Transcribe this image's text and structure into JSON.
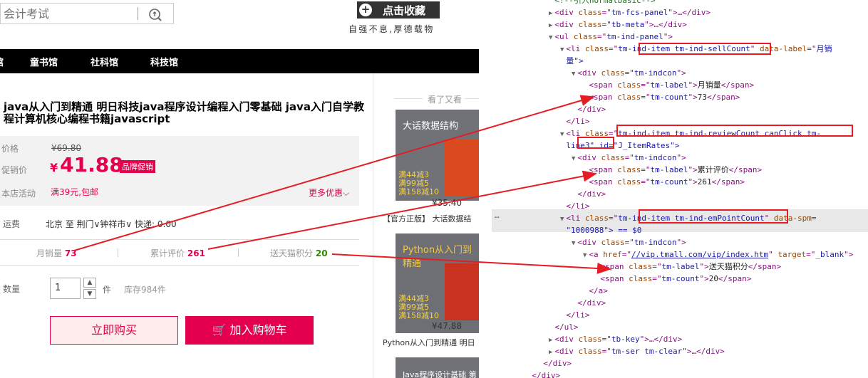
{
  "header": {
    "search_placeholder": "会计考试",
    "favorite_label": "点击收藏",
    "favorite_plus": "+",
    "motto": "自强不息,厚德载物"
  },
  "nav": {
    "items": [
      "童书馆",
      "社科馆",
      "科技馆"
    ]
  },
  "product": {
    "title": "java从入门到精通 明日科技java程序设计编程入门零基础 java入门自学教程计算机核心编程书籍javascript",
    "price_label": "价格",
    "old_price": "¥69.80",
    "promo_price_label": "促销价",
    "promo_price_currency": "¥",
    "promo_price": "41.88",
    "promo_badge": "品牌促销",
    "store_promo_label": "本店活动",
    "store_promo_value": "满39元,包邮",
    "more_promo": "更多优惠",
    "shipping_label": "运费",
    "shipping_value": "北京 至 荆门∨钟祥市∨ 快递: 0.00",
    "stats": [
      {
        "label": "月销量",
        "value": "73"
      },
      {
        "label": "累计评价",
        "value": "261"
      },
      {
        "label": "送天猫积分",
        "value": "20"
      }
    ],
    "qty_label": "数量",
    "qty_value": "1",
    "qty_unit": "件",
    "stock": "库存984件",
    "buy_now": "立即购买",
    "add_cart": "加入购物车"
  },
  "sidebar": {
    "title": "看了又看",
    "items": [
      {
        "cover_title": "大话数据结构",
        "promo": "满44减3\n满99减5\n满158减10",
        "price": "¥35.40",
        "name": "【官方正版】 大话数据结"
      },
      {
        "cover_title": "Python从入门到精通",
        "promo": "满44减3\n满99减5\n满158减10",
        "price": "¥47.88",
        "name": "Python从入门到精通 明日"
      },
      {
        "cover_title": "Java程序设计基础 第"
      }
    ]
  },
  "devtools": {
    "lines": [
      {
        "indent": 6,
        "tri": "",
        "html": "<!--引入normalbasic-->",
        "type": "comment"
      },
      {
        "indent": 6,
        "tri": "▶",
        "tag": "div",
        "attrs": [
          [
            "class",
            "tm-fcs-panel"
          ]
        ],
        "tail": "…</div>"
      },
      {
        "indent": 6,
        "tri": "▶",
        "tag": "div",
        "attrs": [
          [
            "class",
            "tb-meta"
          ]
        ],
        "tail": "…</div>"
      },
      {
        "indent": 6,
        "tri": "▼",
        "tag": "ul",
        "attrs": [
          [
            "class",
            "tm-ind-panel"
          ]
        ],
        "tail": ""
      },
      {
        "indent": 7,
        "tri": "▼",
        "tag": "li",
        "attrs": [
          [
            "class",
            "tm-ind-item tm-ind-sellCount"
          ],
          [
            "data-label",
            "月销"
          ]
        ],
        "tail": ""
      },
      {
        "indent": 7,
        "tri": "",
        "text": "量\">",
        "cont": true
      },
      {
        "indent": 8,
        "tri": "▼",
        "tag": "div",
        "attrs": [
          [
            "class",
            "tm-indcon"
          ]
        ],
        "tail": ""
      },
      {
        "indent": 9,
        "tri": "",
        "tag": "span",
        "attrs": [
          [
            "class",
            "tm-label"
          ]
        ],
        "inner": "月销量"
      },
      {
        "indent": 9,
        "tri": "",
        "tag": "span",
        "attrs": [
          [
            "class",
            "tm-count"
          ]
        ],
        "inner": "73"
      },
      {
        "indent": 8,
        "tri": "",
        "close": "div"
      },
      {
        "indent": 7,
        "tri": "",
        "close": "li"
      },
      {
        "indent": 7,
        "tri": "▼",
        "tag": "li",
        "attrs": [
          [
            "class",
            "tm-ind-item tm-ind-reviewCount canClick tm-"
          ]
        ],
        "tail": ""
      },
      {
        "indent": 7,
        "tri": "",
        "text": "line3\" id=\"J_ItemRates\">",
        "cont": true
      },
      {
        "indent": 8,
        "tri": "▼",
        "tag": "div",
        "attrs": [
          [
            "class",
            "tm-indcon"
          ]
        ],
        "tail": ""
      },
      {
        "indent": 9,
        "tri": "",
        "tag": "span",
        "attrs": [
          [
            "class",
            "tm-label"
          ]
        ],
        "inner": "累计评价"
      },
      {
        "indent": 9,
        "tri": "",
        "tag": "span",
        "attrs": [
          [
            "class",
            "tm-count"
          ]
        ],
        "inner": "261"
      },
      {
        "indent": 8,
        "tri": "",
        "close": "div"
      },
      {
        "indent": 7,
        "tri": "",
        "close": "li"
      },
      {
        "indent": 7,
        "tri": "▼",
        "tag": "li",
        "attrs": [
          [
            "class",
            "tm-ind-item tm-ind-emPointCount"
          ],
          [
            "data-spm",
            ""
          ]
        ],
        "tail": ""
      },
      {
        "indent": 7,
        "tri": "",
        "text": "\"1000988\"> == $0",
        "cont": true
      },
      {
        "indent": 8,
        "tri": "▼",
        "tag": "div",
        "attrs": [
          [
            "class",
            "tm-indcon"
          ]
        ],
        "tail": ""
      },
      {
        "indent": 9,
        "tri": "▼",
        "tag": "a",
        "attrs": [
          [
            "href",
            "//vip.tmall.com/vip/index.htm"
          ],
          [
            "target",
            "_blank"
          ]
        ],
        "tail": ""
      },
      {
        "indent": 10,
        "tri": "",
        "tag": "span",
        "attrs": [
          [
            "class",
            "tm-label"
          ]
        ],
        "inner": "送天猫积分"
      },
      {
        "indent": 10,
        "tri": "",
        "tag": "span",
        "attrs": [
          [
            "class",
            "tm-count"
          ]
        ],
        "inner": "20"
      },
      {
        "indent": 9,
        "tri": "",
        "close": "a"
      },
      {
        "indent": 8,
        "tri": "",
        "close": "div"
      },
      {
        "indent": 7,
        "tri": "",
        "close": "li"
      },
      {
        "indent": 6,
        "tri": "",
        "close": "ul"
      },
      {
        "indent": 6,
        "tri": "▶",
        "tag": "div",
        "attrs": [
          [
            "class",
            "tb-key"
          ]
        ],
        "tail": "…</div>"
      },
      {
        "indent": 6,
        "tri": "▶",
        "tag": "div",
        "attrs": [
          [
            "class",
            "tm-ser tm-clear"
          ]
        ],
        "tail": "…</div>"
      },
      {
        "indent": 5,
        "tri": "",
        "close": "div"
      },
      {
        "indent": 4,
        "tri": "",
        "close": "div"
      }
    ],
    "ellipsis": "…",
    "accent_red": "#e51c23"
  }
}
